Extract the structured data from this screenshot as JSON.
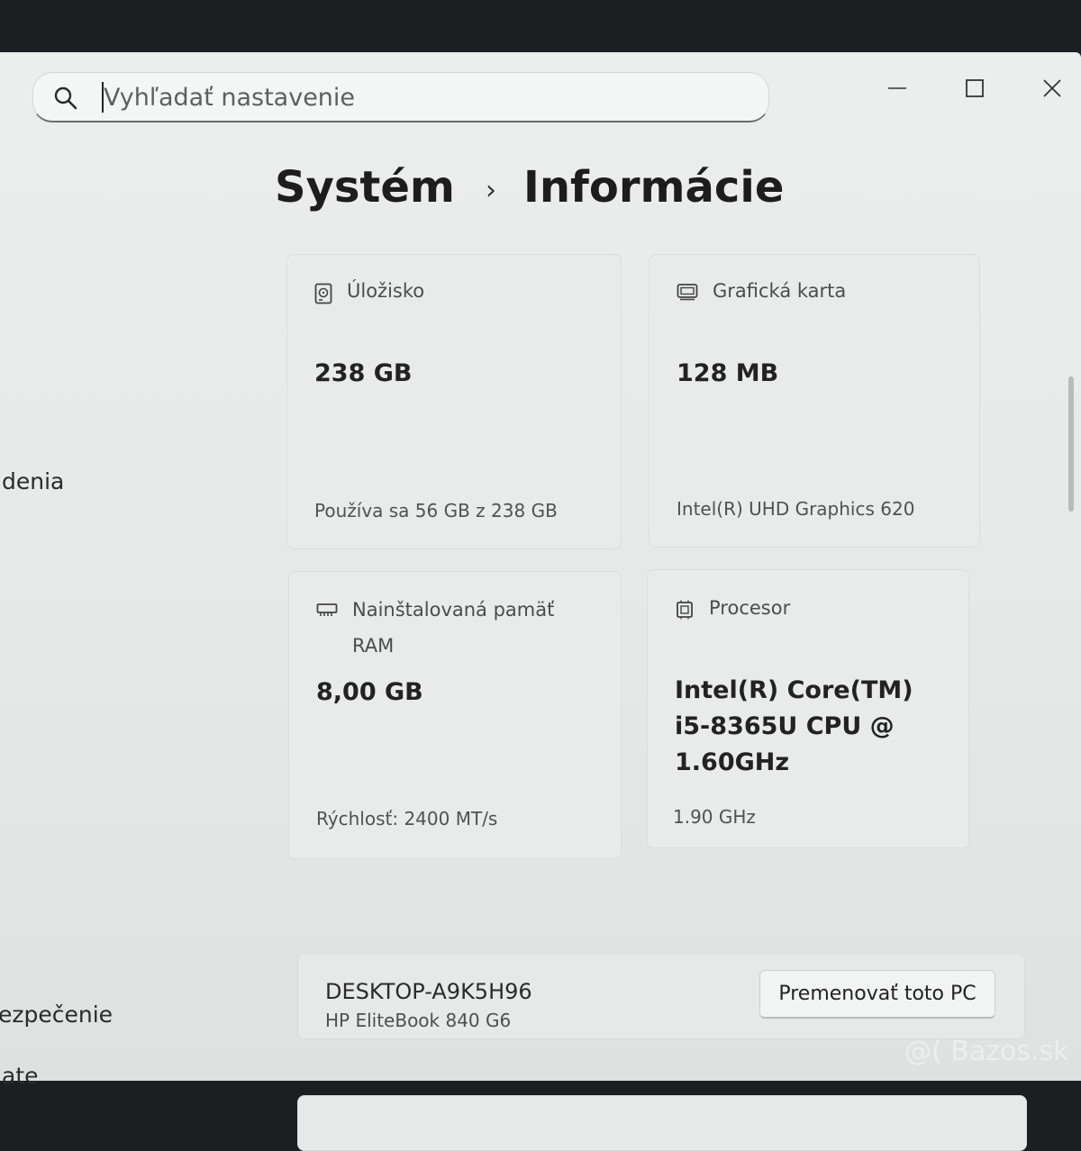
{
  "search": {
    "placeholder": "Vyhľadať nastavenie"
  },
  "breadcrumb": {
    "parent": "Systém",
    "separator": "›",
    "current": "Informácie"
  },
  "sidebar": {
    "items": [
      {
        "label": "denia"
      },
      {
        "label": "ezpečenie"
      },
      {
        "label": "ate"
      }
    ]
  },
  "cards": {
    "storage": {
      "label": "Úložisko",
      "value": "238 GB",
      "detail": "Používa sa 56 GB z 238 GB"
    },
    "gpu": {
      "label": "Grafická karta",
      "value": "128 MB",
      "detail": "Intel(R) UHD Graphics 620"
    },
    "ram": {
      "label_line1": "Nainštalovaná pamäť",
      "label_line2": "RAM",
      "value": "8,00 GB",
      "detail": "Rýchlosť: 2400 MT/s"
    },
    "cpu": {
      "label": "Procesor",
      "value_line1": "Intel(R) Core(TM)",
      "value_line2": "i5-8365U CPU @",
      "value_line3": "1.60GHz",
      "detail": "1.90 GHz"
    }
  },
  "device": {
    "name": "DESKTOP-A9K5H96",
    "model": "HP EliteBook 840 G6",
    "rename_label": "Premenovať toto PC"
  },
  "watermark": "@( Bazos.sk",
  "icons": [
    "search-icon",
    "minimize-icon",
    "maximize-icon",
    "close-icon",
    "storage-icon",
    "gpu-icon",
    "memory-icon",
    "processor-icon"
  ]
}
